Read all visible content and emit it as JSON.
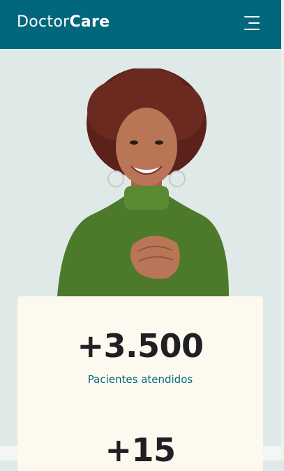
{
  "header": {
    "brand_light": "Doctor",
    "brand_bold": "Care",
    "menu_icon": "hamburger-menu-icon"
  },
  "hero": {
    "image_subject": "smiling woman with curly hair in green turtleneck, hands on chest"
  },
  "stats": [
    {
      "value": "+3.500",
      "label": "Pacientes atendidos"
    },
    {
      "value": "+15",
      "label": ""
    }
  ],
  "colors": {
    "brand": "#00677d",
    "hero_bg": "#dfe9e7",
    "card_bg": "#fdf9ee",
    "text_dark": "#1f1f24"
  }
}
